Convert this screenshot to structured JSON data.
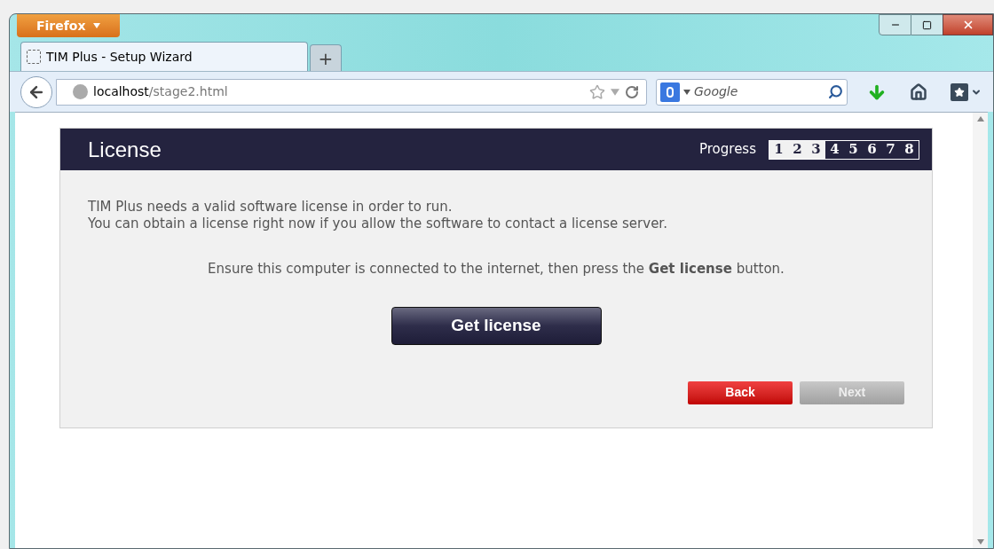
{
  "browser": {
    "menu_button": "Firefox",
    "tabs": [
      {
        "title": "TIM Plus - Setup Wizard",
        "selected": true
      }
    ],
    "new_tab": "+",
    "url_host": "localhost",
    "url_path": "/stage2.html",
    "search_placeholder": "Google"
  },
  "wizard": {
    "title": "License",
    "progress_label": "Progress",
    "steps": [
      {
        "label": "1",
        "done": true
      },
      {
        "label": "2",
        "done": true
      },
      {
        "label": "3",
        "done": true
      },
      {
        "label": "4",
        "done": false
      },
      {
        "label": "5",
        "done": false
      },
      {
        "label": "6",
        "done": false
      },
      {
        "label": "7",
        "done": false
      },
      {
        "label": "8",
        "done": false
      }
    ],
    "intro": [
      "TIM Plus needs a valid software license in order to run.",
      "You can obtain a license right now if you allow the software to contact a license server."
    ],
    "instruction": "Ensure this computer is connected to the internet, then press the **Get license** button.",
    "primary_button": "Get license",
    "nav_buttons": [
      {
        "label": "Back",
        "disabled": false
      },
      {
        "label": "Next",
        "disabled": true
      }
    ]
  }
}
